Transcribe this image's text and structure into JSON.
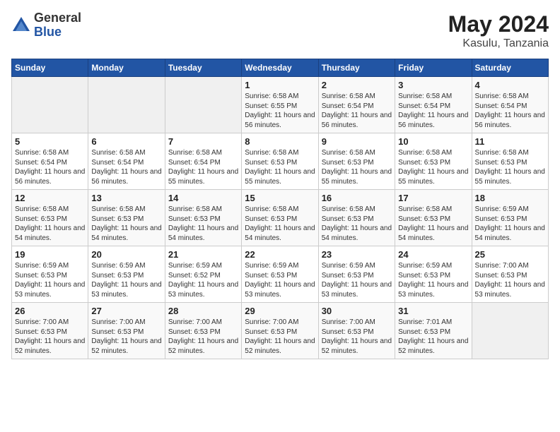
{
  "header": {
    "logo_general": "General",
    "logo_blue": "Blue",
    "month_year": "May 2024",
    "location": "Kasulu, Tanzania"
  },
  "days_of_week": [
    "Sunday",
    "Monday",
    "Tuesday",
    "Wednesday",
    "Thursday",
    "Friday",
    "Saturday"
  ],
  "weeks": [
    [
      {
        "day": "",
        "info": ""
      },
      {
        "day": "",
        "info": ""
      },
      {
        "day": "",
        "info": ""
      },
      {
        "day": "1",
        "info": "Sunrise: 6:58 AM\nSunset: 6:55 PM\nDaylight: 11 hours\nand 56 minutes."
      },
      {
        "day": "2",
        "info": "Sunrise: 6:58 AM\nSunset: 6:54 PM\nDaylight: 11 hours\nand 56 minutes."
      },
      {
        "day": "3",
        "info": "Sunrise: 6:58 AM\nSunset: 6:54 PM\nDaylight: 11 hours\nand 56 minutes."
      },
      {
        "day": "4",
        "info": "Sunrise: 6:58 AM\nSunset: 6:54 PM\nDaylight: 11 hours\nand 56 minutes."
      }
    ],
    [
      {
        "day": "5",
        "info": "Sunrise: 6:58 AM\nSunset: 6:54 PM\nDaylight: 11 hours\nand 56 minutes."
      },
      {
        "day": "6",
        "info": "Sunrise: 6:58 AM\nSunset: 6:54 PM\nDaylight: 11 hours\nand 56 minutes."
      },
      {
        "day": "7",
        "info": "Sunrise: 6:58 AM\nSunset: 6:54 PM\nDaylight: 11 hours\nand 55 minutes."
      },
      {
        "day": "8",
        "info": "Sunrise: 6:58 AM\nSunset: 6:53 PM\nDaylight: 11 hours\nand 55 minutes."
      },
      {
        "day": "9",
        "info": "Sunrise: 6:58 AM\nSunset: 6:53 PM\nDaylight: 11 hours\nand 55 minutes."
      },
      {
        "day": "10",
        "info": "Sunrise: 6:58 AM\nSunset: 6:53 PM\nDaylight: 11 hours\nand 55 minutes."
      },
      {
        "day": "11",
        "info": "Sunrise: 6:58 AM\nSunset: 6:53 PM\nDaylight: 11 hours\nand 55 minutes."
      }
    ],
    [
      {
        "day": "12",
        "info": "Sunrise: 6:58 AM\nSunset: 6:53 PM\nDaylight: 11 hours\nand 54 minutes."
      },
      {
        "day": "13",
        "info": "Sunrise: 6:58 AM\nSunset: 6:53 PM\nDaylight: 11 hours\nand 54 minutes."
      },
      {
        "day": "14",
        "info": "Sunrise: 6:58 AM\nSunset: 6:53 PM\nDaylight: 11 hours\nand 54 minutes."
      },
      {
        "day": "15",
        "info": "Sunrise: 6:58 AM\nSunset: 6:53 PM\nDaylight: 11 hours\nand 54 minutes."
      },
      {
        "day": "16",
        "info": "Sunrise: 6:58 AM\nSunset: 6:53 PM\nDaylight: 11 hours\nand 54 minutes."
      },
      {
        "day": "17",
        "info": "Sunrise: 6:58 AM\nSunset: 6:53 PM\nDaylight: 11 hours\nand 54 minutes."
      },
      {
        "day": "18",
        "info": "Sunrise: 6:59 AM\nSunset: 6:53 PM\nDaylight: 11 hours\nand 54 minutes."
      }
    ],
    [
      {
        "day": "19",
        "info": "Sunrise: 6:59 AM\nSunset: 6:53 PM\nDaylight: 11 hours\nand 53 minutes."
      },
      {
        "day": "20",
        "info": "Sunrise: 6:59 AM\nSunset: 6:53 PM\nDaylight: 11 hours\nand 53 minutes."
      },
      {
        "day": "21",
        "info": "Sunrise: 6:59 AM\nSunset: 6:52 PM\nDaylight: 11 hours\nand 53 minutes."
      },
      {
        "day": "22",
        "info": "Sunrise: 6:59 AM\nSunset: 6:53 PM\nDaylight: 11 hours\nand 53 minutes."
      },
      {
        "day": "23",
        "info": "Sunrise: 6:59 AM\nSunset: 6:53 PM\nDaylight: 11 hours\nand 53 minutes."
      },
      {
        "day": "24",
        "info": "Sunrise: 6:59 AM\nSunset: 6:53 PM\nDaylight: 11 hours\nand 53 minutes."
      },
      {
        "day": "25",
        "info": "Sunrise: 7:00 AM\nSunset: 6:53 PM\nDaylight: 11 hours\nand 53 minutes."
      }
    ],
    [
      {
        "day": "26",
        "info": "Sunrise: 7:00 AM\nSunset: 6:53 PM\nDaylight: 11 hours\nand 52 minutes."
      },
      {
        "day": "27",
        "info": "Sunrise: 7:00 AM\nSunset: 6:53 PM\nDaylight: 11 hours\nand 52 minutes."
      },
      {
        "day": "28",
        "info": "Sunrise: 7:00 AM\nSunset: 6:53 PM\nDaylight: 11 hours\nand 52 minutes."
      },
      {
        "day": "29",
        "info": "Sunrise: 7:00 AM\nSunset: 6:53 PM\nDaylight: 11 hours\nand 52 minutes."
      },
      {
        "day": "30",
        "info": "Sunrise: 7:00 AM\nSunset: 6:53 PM\nDaylight: 11 hours\nand 52 minutes."
      },
      {
        "day": "31",
        "info": "Sunrise: 7:01 AM\nSunset: 6:53 PM\nDaylight: 11 hours\nand 52 minutes."
      },
      {
        "day": "",
        "info": ""
      }
    ]
  ]
}
